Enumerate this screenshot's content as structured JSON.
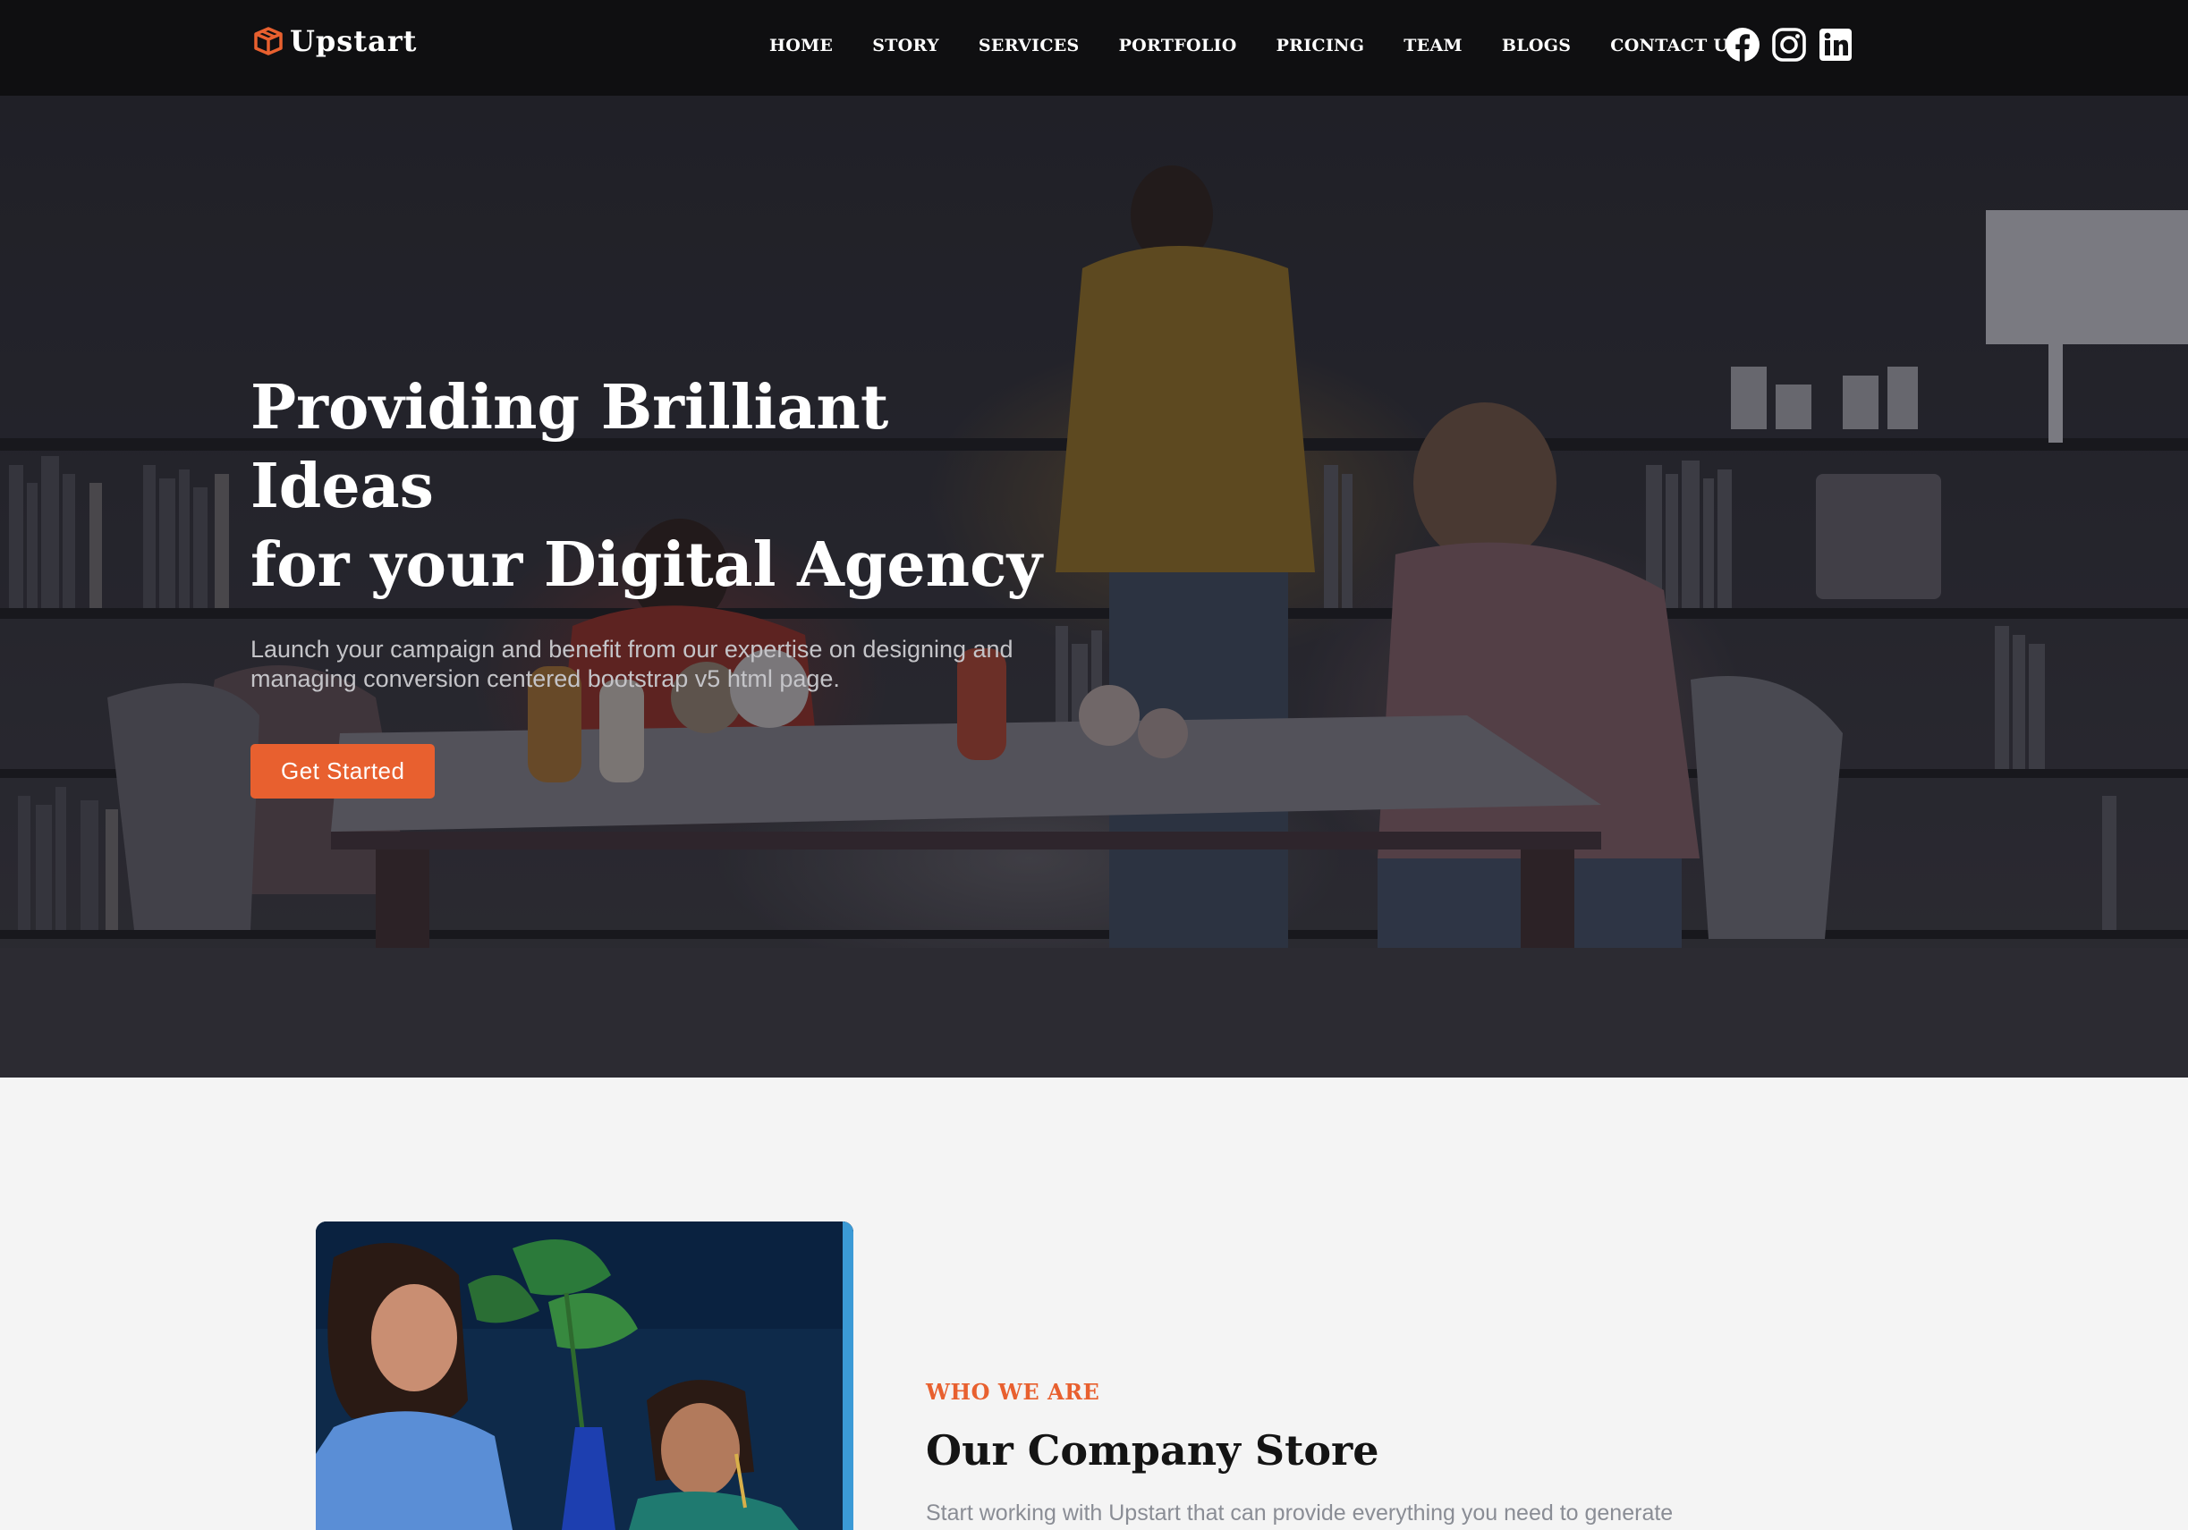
{
  "brand": {
    "name": "Upstart",
    "accent_color": "#e8602f",
    "logo_icon": "box-logo-icon"
  },
  "nav": {
    "items": [
      {
        "label": "HOME"
      },
      {
        "label": "STORY"
      },
      {
        "label": "SERVICES"
      },
      {
        "label": "PORTFOLIO"
      },
      {
        "label": "PRICING"
      },
      {
        "label": "TEAM"
      },
      {
        "label": "BLOGS"
      },
      {
        "label": "CONTACT US"
      }
    ],
    "social": [
      {
        "icon": "facebook-icon"
      },
      {
        "icon": "instagram-icon"
      },
      {
        "icon": "linkedin-icon"
      }
    ]
  },
  "hero": {
    "title_line1": "Providing Brilliant Ideas",
    "title_line2": "for your Digital Agency",
    "subtitle": "Launch your campaign and benefit from our expertise on designing and managing conversion centered bootstrap v5 html page.",
    "cta_label": "Get Started"
  },
  "about": {
    "eyebrow": "WHO WE ARE",
    "title": "Our Company Store",
    "body": "Start working with Upstart that can provide everything you need to generate"
  }
}
